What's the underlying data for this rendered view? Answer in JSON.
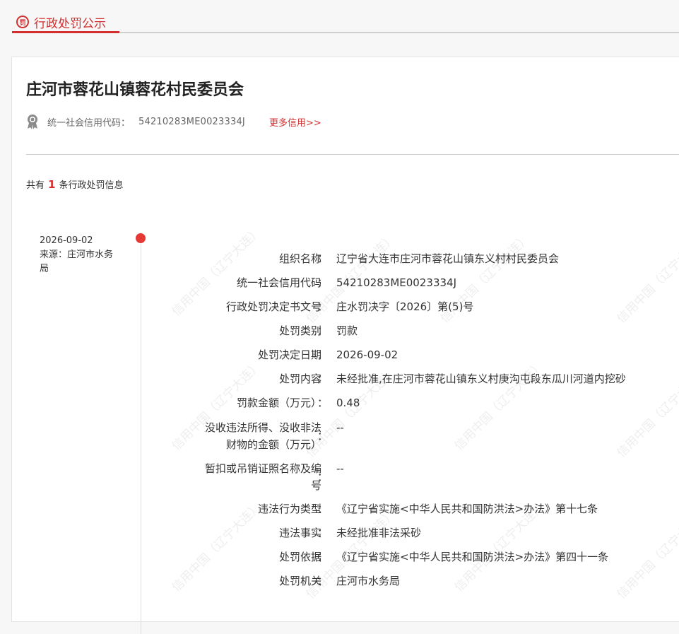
{
  "tab": {
    "icon_glyph": "罚",
    "title": "行政处罚公示"
  },
  "org": {
    "name": "庄河市蓉花山镇蓉花村民委员会",
    "credit_label": "统一社会信用代码：",
    "credit_code": "54210283ME0023334J",
    "more_link": "更多信用>>"
  },
  "summary": {
    "prefix": "共有",
    "count": "1",
    "suffix": "条行政处罚信息"
  },
  "record": {
    "date": "2026-09-02",
    "source": "来源：庄河市水务局",
    "fields": [
      {
        "label": "组织名称",
        "value": "辽宁省大连市庄河市蓉花山镇东义村村民委员会"
      },
      {
        "label": "统一社会信用代码",
        "value": "54210283ME0023334J"
      },
      {
        "label": "行政处罚决定书文号",
        "value": "庄水罚决字〔2026〕第(5)号"
      },
      {
        "label": "处罚类别",
        "value": "罚款"
      },
      {
        "label": "处罚决定日期",
        "value": "2026-09-02"
      },
      {
        "label": "处罚内容",
        "value": "未经批准,在庄河市蓉花山镇东义村庚沟屯段东瓜川河道内挖砂"
      },
      {
        "label": "罚款金额（万元）",
        "value": "0.48"
      },
      {
        "label_lines": [
          "没收违法所得、没收非法",
          "财物的金额（万元）"
        ],
        "value": "--"
      },
      {
        "label_lines": [
          "暂扣或吊销证照名称及编",
          "号"
        ],
        "value": "--"
      },
      {
        "label": "违法行为类型",
        "value": "《辽宁省实施<中华人民共和国防洪法>办法》第十七条"
      },
      {
        "label": "违法事实",
        "value": "未经批准非法采砂"
      },
      {
        "label": "处罚依据",
        "value": "《辽宁省实施<中华人民共和国防洪法>办法》第四十一条"
      },
      {
        "label": "处罚机关",
        "value": "庄河市水务局"
      }
    ],
    "colon": "："
  },
  "watermark": {
    "text": "信用中国（辽宁大连）"
  },
  "colors": {
    "accent": "#d32f2f",
    "dot": "#e53935"
  },
  "icons": {
    "tab": "penalty-badge-icon",
    "credit": "medal-icon"
  }
}
